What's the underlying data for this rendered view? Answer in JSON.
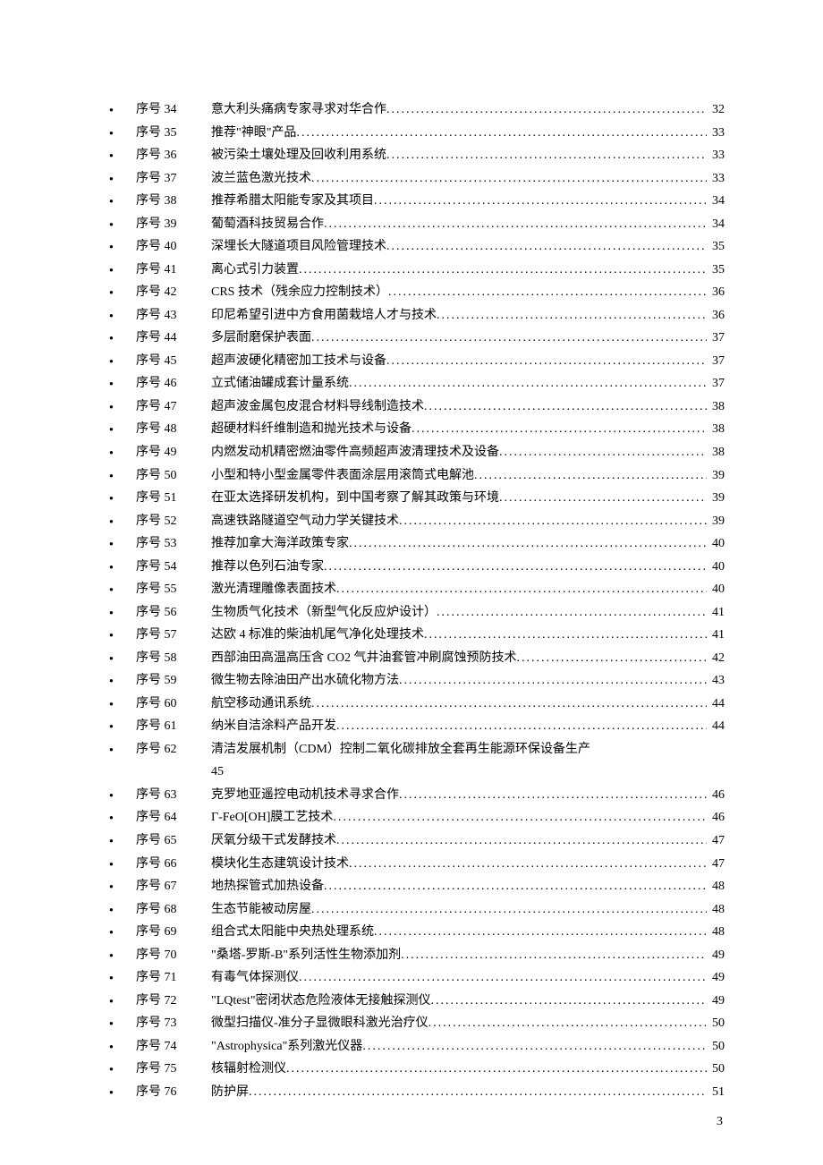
{
  "page_number": "3",
  "entries": [
    {
      "seq": "序号 34",
      "title": "意大利头痛病专家寻求对华合作",
      "page": "32"
    },
    {
      "seq": "序号 35",
      "title": "推荐\"神眼\"产品",
      "page": "33"
    },
    {
      "seq": "序号 36",
      "title": "被污染土壤处理及回收利用系统",
      "page": "33"
    },
    {
      "seq": "序号 37",
      "title": "波兰蓝色激光技术",
      "page": "33"
    },
    {
      "seq": "序号 38",
      "title": "推荐希腊太阳能专家及其项目",
      "page": "34"
    },
    {
      "seq": "序号 39",
      "title": " 葡萄酒科技贸易合作",
      "page": "34"
    },
    {
      "seq": "序号 40",
      "title": "深埋长大隧道项目风险管理技术",
      "page": "35"
    },
    {
      "seq": "序号 41",
      "title": "离心式引力装置",
      "page": "35"
    },
    {
      "seq": "序号 42",
      "title": "CRS 技术（残余应力控制技术）",
      "page": "36"
    },
    {
      "seq": "序号 43",
      "title": "印尼希望引进中方食用菌栽培人才与技术",
      "page": "36"
    },
    {
      "seq": "序号 44",
      "title": "多层耐磨保护表面",
      "page": "37"
    },
    {
      "seq": "序号 45",
      "title": "超声波硬化精密加工技术与设备",
      "page": "37"
    },
    {
      "seq": "序号 46",
      "title": "立式储油罐成套计量系统",
      "page": "37"
    },
    {
      "seq": "序号 47",
      "title": "超声波金属包皮混合材料导线制造技术",
      "page": "38"
    },
    {
      "seq": "序号 48",
      "title": "超硬材料纤维制造和抛光技术与设备",
      "page": "38"
    },
    {
      "seq": "序号 49",
      "title": "内燃发动机精密燃油零件高频超声波清理技术及设备",
      "page": "38"
    },
    {
      "seq": "序号 50",
      "title": "小型和特小型金属零件表面涂层用滚筒式电解池",
      "page": "39"
    },
    {
      "seq": "序号 51",
      "title": "在亚太选择研发机构，到中国考察了解其政策与环境",
      "page": "39"
    },
    {
      "seq": "序号 52",
      "title": "高速铁路隧道空气动力学关键技术",
      "page": "39"
    },
    {
      "seq": "序号 53",
      "title": "推荐加拿大海洋政策专家",
      "page": "40"
    },
    {
      "seq": "序号 54",
      "title": "推荐以色列石油专家",
      "page": "40"
    },
    {
      "seq": "序号 55",
      "title": "激光清理雕像表面技术",
      "page": "40"
    },
    {
      "seq": "序号 56",
      "title": "生物质气化技术（新型气化反应炉设计）",
      "page": "41"
    },
    {
      "seq": "序号 57",
      "title": "达欧 4 标准的柴油机尾气净化处理技术",
      "page": "41"
    },
    {
      "seq": "序号 58",
      "title": "西部油田高温高压含 CO2 气井油套管冲刷腐蚀预防技术 ",
      "page": "42"
    },
    {
      "seq": "序号 59",
      "title": "微生物去除油田产出水硫化物方法",
      "page": "43"
    },
    {
      "seq": "序号 60",
      "title": "航空移动通讯系统",
      "page": "44"
    },
    {
      "seq": "序号 61",
      "title": "纳米自洁涂料产品开发",
      "page": "44"
    },
    {
      "seq": "序号 62",
      "title": "清洁发展机制（CDM）控制二氧化碳排放全套再生能源环保设备生产",
      "page": "45",
      "wrap": true
    },
    {
      "seq": "序号 63",
      "title": "克罗地亚遥控电动机技术寻求合作",
      "page": "46"
    },
    {
      "seq": "序号 64",
      "title": "Г-FeO[OH]膜工艺技术",
      "page": "46"
    },
    {
      "seq": "序号 65",
      "title": "厌氧分级干式发酵技术",
      "page": "47"
    },
    {
      "seq": "序号 66",
      "title": "模块化生态建筑设计技术",
      "page": "47"
    },
    {
      "seq": "序号 67",
      "title": "地热探管式加热设备",
      "page": "48"
    },
    {
      "seq": "序号 68",
      "title": "生态节能被动房屋",
      "page": "48"
    },
    {
      "seq": "序号 69",
      "title": "组合式太阳能中央热处理系统",
      "page": "48"
    },
    {
      "seq": "序号 70",
      "title": "\"桑塔-罗斯-B\"系列活性生物添加剂 ",
      "page": "49"
    },
    {
      "seq": "序号 71",
      "title": "有毒气体探测仪",
      "page": "49"
    },
    {
      "seq": "序号 72",
      "title": "\"LQtest\"密闭状态危险液体无接触探测仪 ",
      "page": "49"
    },
    {
      "seq": "序号 73",
      "title": "微型扫描仪-准分子显微眼科激光治疗仪 ",
      "page": "50"
    },
    {
      "seq": "序号 74",
      "title": "\"Astrophysica\"系列激光仪器",
      "page": "50"
    },
    {
      "seq": "序号 75",
      "title": "核辐射检测仪",
      "page": "50"
    },
    {
      "seq": "序号 76",
      "title": "防护屏",
      "page": "51"
    }
  ]
}
